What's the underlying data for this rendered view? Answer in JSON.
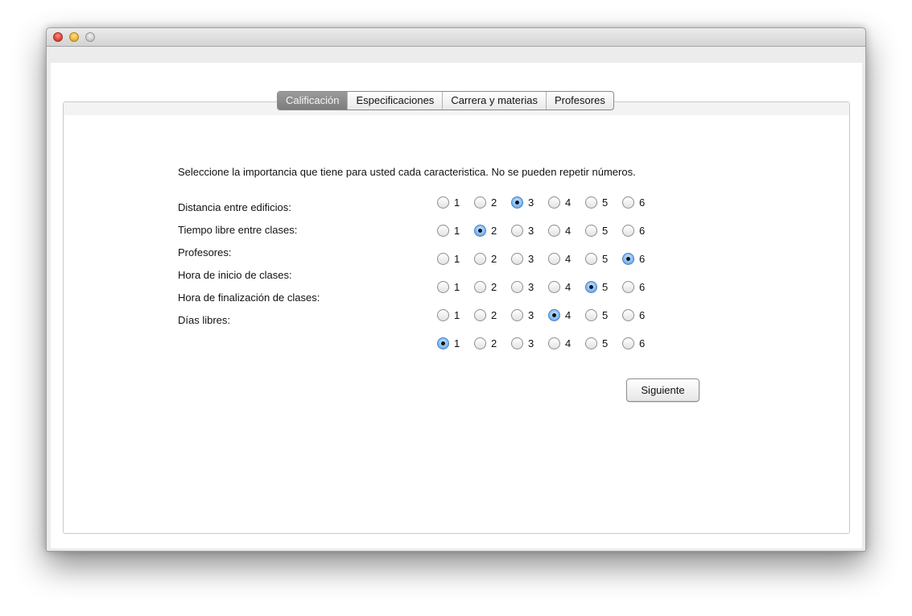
{
  "window": {
    "title": ""
  },
  "tabs": [
    {
      "label": "Calificación",
      "selected": true
    },
    {
      "label": "Especificaciones",
      "selected": false
    },
    {
      "label": "Carrera y materias",
      "selected": false
    },
    {
      "label": "Profesores",
      "selected": false
    }
  ],
  "instruction": "Seleccione la importancia que tiene para usted cada caracteristica. No se pueden repetir números.",
  "criteria": [
    "Distancia entre edificios:",
    "Tiempo libre entre clases:",
    "Profesores:",
    "Hora de inicio de clases:",
    "Hora de finalización de clases:",
    "Días libres:"
  ],
  "options": [
    "1",
    "2",
    "3",
    "4",
    "5",
    "6"
  ],
  "radio_groups": [
    {
      "selected": "3"
    },
    {
      "selected": "2"
    },
    {
      "selected": "6"
    },
    {
      "selected": "5"
    },
    {
      "selected": "4"
    },
    {
      "selected": "1"
    }
  ],
  "button": {
    "label": "Siguiente"
  },
  "colors": {
    "accent": "#5a9ce6",
    "selected_tab": "#8a8a8a"
  }
}
